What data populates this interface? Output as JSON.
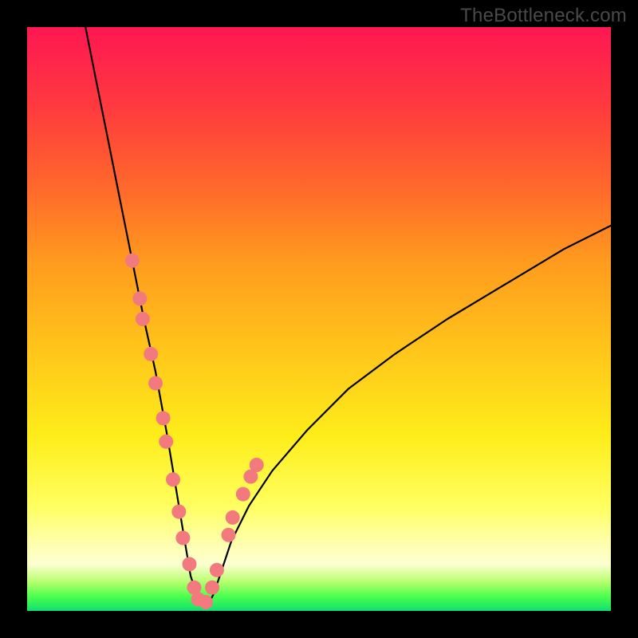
{
  "watermark": "TheBottleneck.com",
  "chart_data": {
    "type": "line",
    "title": "",
    "xlabel": "",
    "ylabel": "",
    "xlim": [
      0,
      100
    ],
    "ylim": [
      0,
      100
    ],
    "grid": false,
    "series": [
      {
        "name": "bottleneck-curve",
        "x": [
          10,
          12,
          14,
          16,
          18,
          20,
          22,
          24,
          25,
          26,
          27,
          28,
          29,
          30,
          31,
          32,
          33,
          35,
          38,
          42,
          48,
          55,
          63,
          72,
          82,
          92,
          100
        ],
        "y": [
          100,
          90,
          80,
          70,
          60,
          50,
          41,
          30,
          24,
          18,
          12,
          6,
          3,
          1,
          1,
          3,
          6,
          12,
          18,
          24,
          31,
          38,
          44,
          50,
          56,
          62,
          66
        ],
        "color": "#000000",
        "line_width": 2.2
      }
    ],
    "points": {
      "x": [
        18.0,
        19.3,
        19.8,
        21.2,
        22.0,
        23.3,
        23.8,
        25.0,
        26.0,
        26.7,
        27.8,
        28.6,
        29.3,
        30.6,
        31.7,
        32.5,
        34.5,
        35.2,
        37.0,
        38.3,
        39.3
      ],
      "y": [
        60.0,
        53.5,
        50.0,
        44.0,
        39.0,
        33.0,
        29.0,
        22.5,
        17.0,
        12.5,
        8.0,
        4.0,
        2.0,
        1.5,
        4.0,
        7.0,
        13.0,
        16.0,
        20.0,
        23.0,
        25.0
      ],
      "color": "#f27a7e",
      "radius": 9
    },
    "background_gradient": {
      "top": "#ff1752",
      "upper_mid": "#ffc41a",
      "lower_mid": "#ffff60",
      "bottom": "#10e070"
    }
  }
}
